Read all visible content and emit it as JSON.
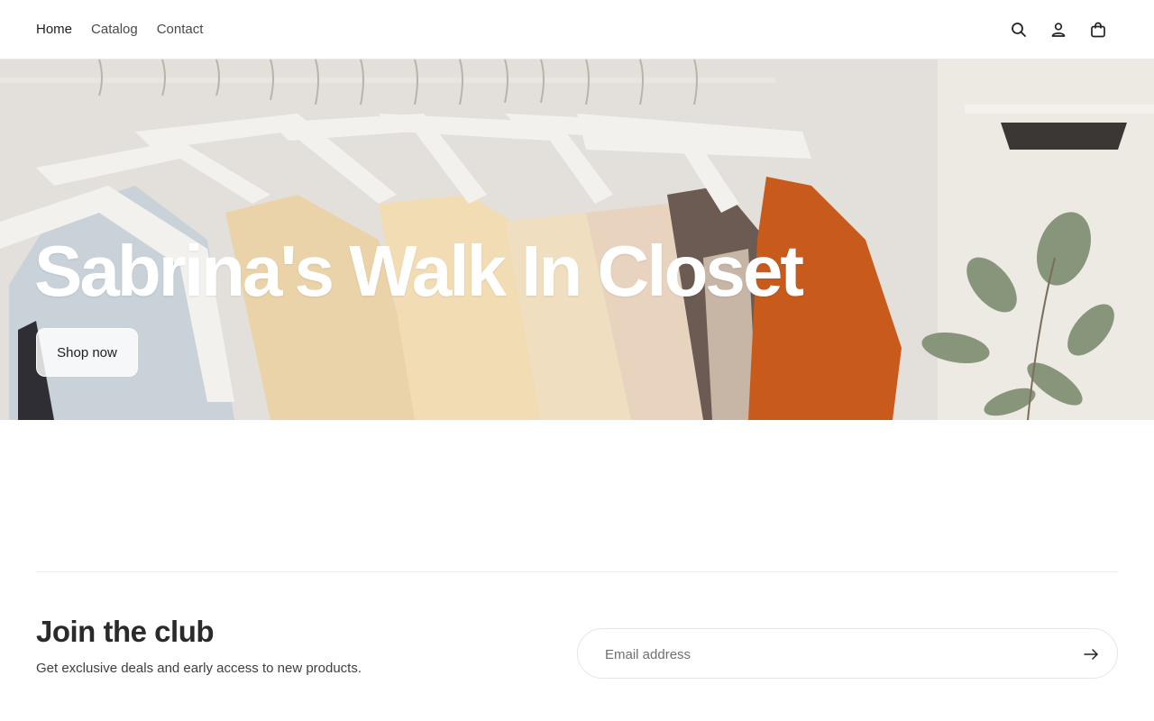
{
  "header": {
    "nav": [
      {
        "label": "Home"
      },
      {
        "label": "Catalog"
      },
      {
        "label": "Contact"
      }
    ],
    "icons": [
      "search-icon",
      "account-icon",
      "cart-icon"
    ]
  },
  "hero": {
    "title": "Sabrina's Walk In Closet",
    "button_label": "Shop now"
  },
  "newsletter": {
    "title": "Join the club",
    "subtitle": "Get exclusive deals and early access to new products.",
    "email_placeholder": "Email address",
    "submit_icon": "arrow-right-icon"
  },
  "colors": {
    "text": "#2b2b2b",
    "hero_text": "#ffffff",
    "orange_garment": "#c85a1c"
  }
}
